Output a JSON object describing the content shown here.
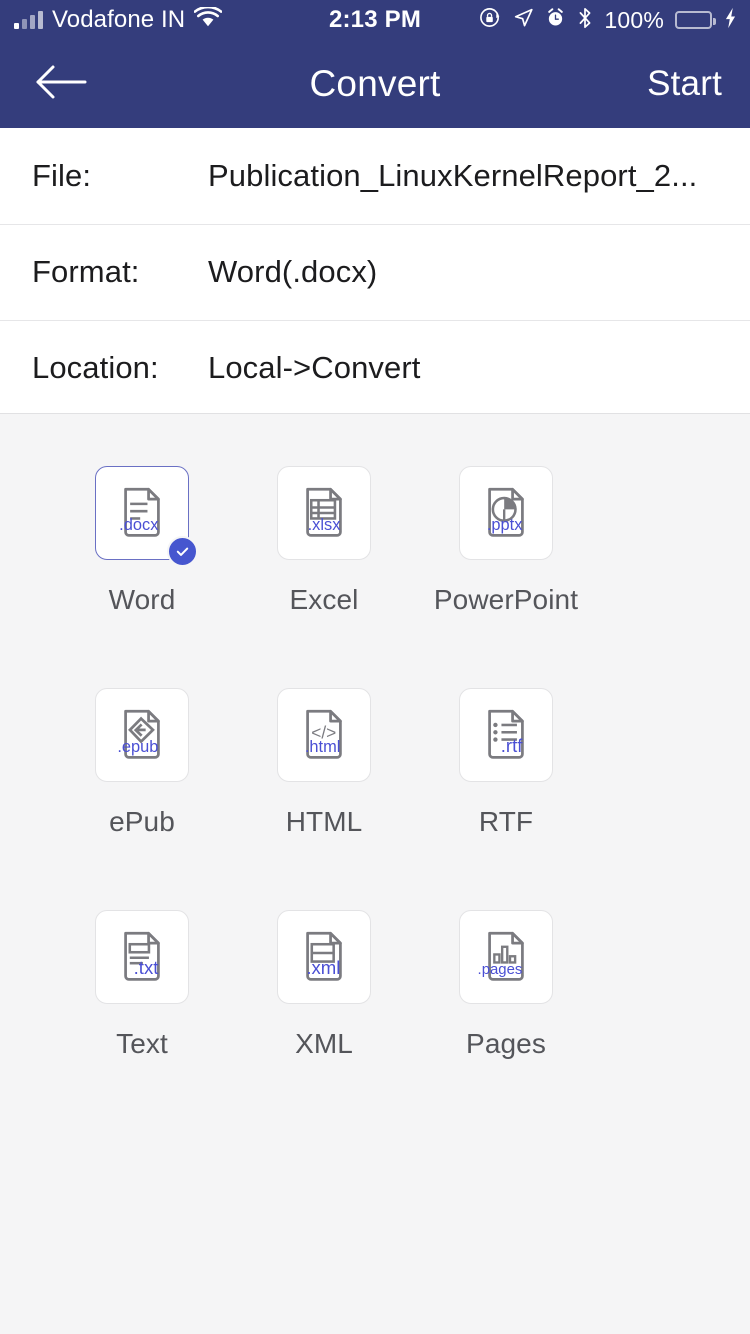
{
  "status_bar": {
    "carrier": "Vodafone IN",
    "wifi_icon": "wifi-icon",
    "signal_icon": "cellular-signal-icon",
    "time": "2:13 PM",
    "rotation_lock_icon": "rotation-lock-icon",
    "location_icon": "location-arrow-icon",
    "alarm_icon": "alarm-clock-icon",
    "bluetooth_icon": "bluetooth-icon",
    "battery_percent": "100%",
    "battery_level": 100,
    "charging_icon": "charging-bolt-icon",
    "background_color": "#343d7c",
    "battery_fill_color": "#6ddc6d"
  },
  "nav_bar": {
    "back_icon": "back-arrow-icon",
    "title": "Convert",
    "action_label": "Start",
    "background_color": "#343d7c",
    "text_color": "#ffffff"
  },
  "info_rows": [
    {
      "label": "File:",
      "value": "Publication_LinuxKernelReport_2..."
    },
    {
      "label": "Format:",
      "value": "Word(.docx)"
    },
    {
      "label": "Location:",
      "value": "Local->Convert"
    }
  ],
  "format_grid": {
    "selected_format": "Word",
    "selected_color": "#4656cf",
    "extension_text_color": "#4a4fd4",
    "items": [
      {
        "label": "Word",
        "ext": ".docx",
        "glyph": "document-lines-icon",
        "selected": true
      },
      {
        "label": "Excel",
        "ext": ".xlsx",
        "glyph": "spreadsheet-icon",
        "selected": false
      },
      {
        "label": "PowerPoint",
        "ext": ".pptx",
        "glyph": "pie-chart-icon",
        "selected": false
      },
      {
        "label": "ePub",
        "ext": ".epub",
        "glyph": "epub-diamond-icon",
        "selected": false
      },
      {
        "label": "HTML",
        "ext": ".html",
        "glyph": "code-brackets-icon",
        "selected": false
      },
      {
        "label": "RTF",
        "ext": ".rtf",
        "glyph": "bullet-list-icon",
        "selected": false
      },
      {
        "label": "Text",
        "ext": ".txt",
        "glyph": "text-lines-icon",
        "selected": false
      },
      {
        "label": "XML",
        "ext": ".xml",
        "glyph": "table-rows-icon",
        "selected": false
      },
      {
        "label": "Pages",
        "ext": ".pages",
        "glyph": "bar-chart-icon",
        "selected": false
      }
    ]
  }
}
